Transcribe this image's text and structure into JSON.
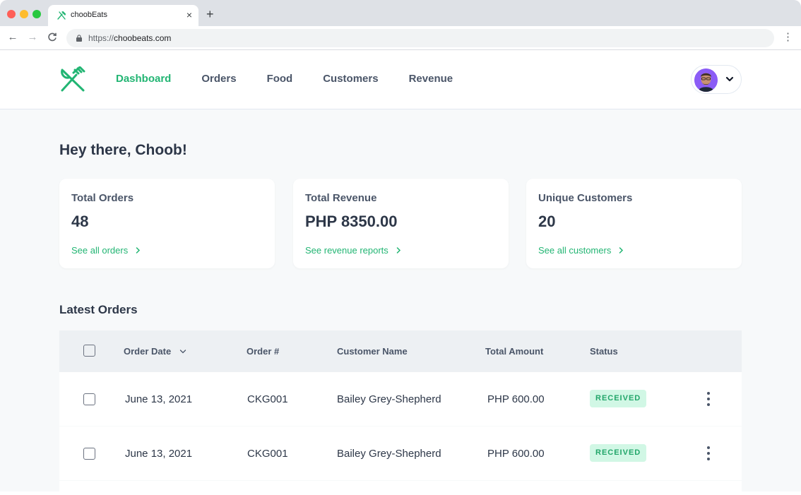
{
  "browser": {
    "tab_title": "choobEats",
    "tab_close": "×",
    "new_tab": "+",
    "url_scheme": "https://",
    "url_host": "choobeats.com",
    "back": "←",
    "forward": "→",
    "reload": "C",
    "menu": "⋮"
  },
  "nav": {
    "items": [
      {
        "label": "Dashboard",
        "active": true
      },
      {
        "label": "Orders",
        "active": false
      },
      {
        "label": "Food",
        "active": false
      },
      {
        "label": "Customers",
        "active": false
      },
      {
        "label": "Revenue",
        "active": false
      }
    ]
  },
  "greeting": "Hey there, Choob!",
  "cards": [
    {
      "label": "Total Orders",
      "value": "48",
      "link": "See all orders"
    },
    {
      "label": "Total Revenue",
      "value": "PHP 8350.00",
      "link": "See revenue reports"
    },
    {
      "label": "Unique Customers",
      "value": "20",
      "link": "See all customers"
    }
  ],
  "latest_orders": {
    "title": "Latest Orders",
    "columns": {
      "date": "Order Date",
      "order": "Order #",
      "customer": "Customer Name",
      "amount": "Total Amount",
      "status": "Status"
    },
    "rows": [
      {
        "date": "June 13, 2021",
        "order": "CKG001",
        "customer": "Bailey Grey-Shepherd",
        "amount": "PHP 600.00",
        "status": "RECEIVED"
      },
      {
        "date": "June 13, 2021",
        "order": "CKG001",
        "customer": "Bailey Grey-Shepherd",
        "amount": "PHP 600.00",
        "status": "RECEIVED"
      }
    ]
  },
  "colors": {
    "accent": "#22b573",
    "badge_bg": "#d1f7e5",
    "badge_text": "#22a66a",
    "page_bg": "#f7f9fa"
  }
}
